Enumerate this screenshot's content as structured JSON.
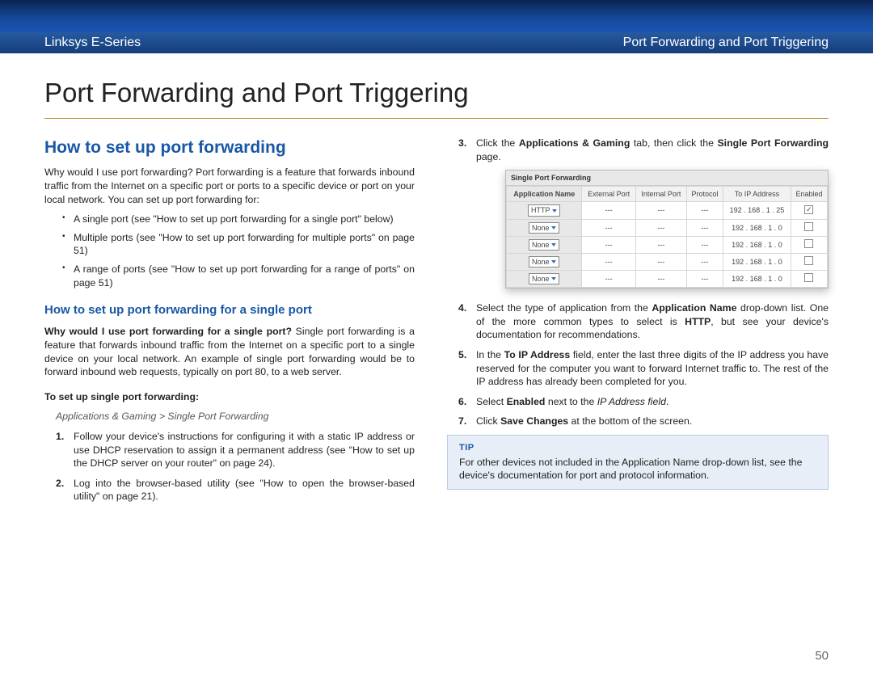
{
  "header": {
    "left": "Linksys E-Series",
    "right": "Port Forwarding and Port Triggering"
  },
  "page_title": "Port Forwarding and Port Triggering",
  "page_number": "50",
  "left_col": {
    "h2": "How to set up port forwarding",
    "intro": "Why would I use port forwarding? Port forwarding is a feature that forwards inbound traffic from the Internet on a specific port or ports to a specific device or port on your local network. You can set up port forwarding for:",
    "bullets": [
      "A single port (see \"How to set up port forwarding for a single port\" below)",
      "Multiple ports (see \"How to set up port forwarding for multiple ports\" on page 51)",
      "A range of ports (see \"How to set up port forwarding for a range of ports\" on page 51)"
    ],
    "h3": "How to set up port forwarding for a single port",
    "single_intro_bold": "Why would I use port forwarding for a single port?",
    "single_intro_rest": " Single port forwarding is a feature that forwards inbound traffic from the Internet on a specific port to a single device on your local network. An example of single port forwarding would be to forward inbound web requests, typically on port 80, to a web server.",
    "setup_label": "To set up single port forwarding:",
    "breadcrumb": "Applications & Gaming > Single Port Forwarding",
    "steps": [
      "Follow your device's instructions for configuring it with a static IP address or use DHCP reservation to assign it a permanent address (see \"How to set up the DHCP server on your router\" on page 24).",
      "Log into the browser-based utility (see \"How to open the browser-based utility\" on page 21)."
    ]
  },
  "right_col": {
    "step3_pre": "Click the ",
    "step3_b1": "Applications & Gaming",
    "step3_mid": " tab, then click the ",
    "step3_b2": "Single Port Forwarding",
    "step3_post": " page.",
    "embed": {
      "tab": "Single Port Forwarding",
      "headers": [
        "Application Name",
        "External Port",
        "Internal Port",
        "Protocol",
        "To IP Address",
        "Enabled"
      ],
      "rows": [
        {
          "app": "HTTP",
          "ext": "---",
          "int": "---",
          "proto": "---",
          "ip": "192 . 168 . 1 . 25",
          "enabled": true
        },
        {
          "app": "None",
          "ext": "---",
          "int": "---",
          "proto": "---",
          "ip": "192 . 168 . 1 . 0",
          "enabled": false
        },
        {
          "app": "None",
          "ext": "---",
          "int": "---",
          "proto": "---",
          "ip": "192 . 168 . 1 . 0",
          "enabled": false
        },
        {
          "app": "None",
          "ext": "---",
          "int": "---",
          "proto": "---",
          "ip": "192 . 168 . 1 . 0",
          "enabled": false
        },
        {
          "app": "None",
          "ext": "---",
          "int": "---",
          "proto": "---",
          "ip": "192 . 168 . 1 . 0",
          "enabled": false
        }
      ]
    },
    "step4_pre": "Select the type of application from the ",
    "step4_b1": "Application Name",
    "step4_mid": " drop-down list. One of the more common types to select is ",
    "step4_b2": "HTTP",
    "step4_post": ", but see your device's documentation for recommendations.",
    "step5_pre": "In the ",
    "step5_b1": "To IP Address",
    "step5_post": " field, enter the last three digits of the IP address you have reserved for the computer you want to forward Internet traffic to. The rest of the IP address has already been completed for you.",
    "step6_pre": "Select ",
    "step6_b1": "Enabled",
    "step6_mid": " next to the ",
    "step6_i": "IP Address field",
    "step6_post": ".",
    "step7_pre": "Click ",
    "step7_b1": "Save Changes",
    "step7_post": " at the bottom of the screen.",
    "tip_label": "TIP",
    "tip_body": "For other devices not included in the Application Name drop-down list, see the device's documentation for port and protocol information."
  }
}
